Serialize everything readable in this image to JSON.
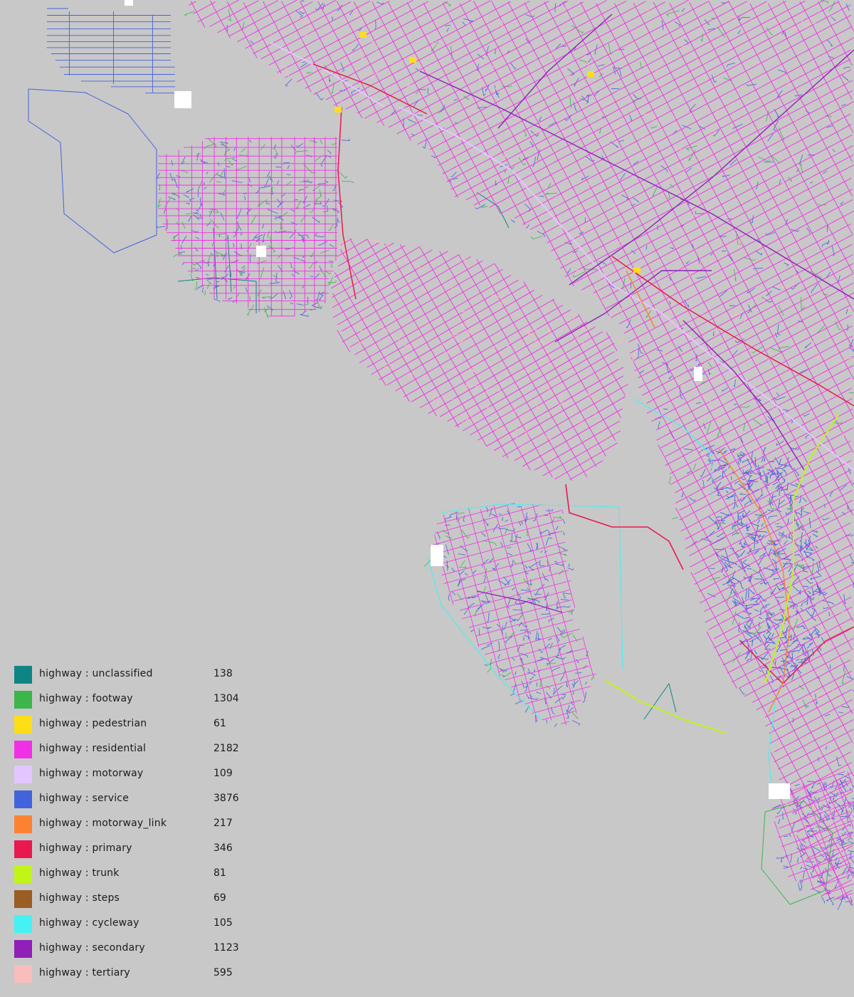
{
  "map": {
    "background": "#c8c8c8",
    "land_color": "#c8c8c8"
  },
  "legend": {
    "items": [
      {
        "key": "unclassified",
        "label": "highway : unclassified",
        "count": "138",
        "color": "#0e8585"
      },
      {
        "key": "footway",
        "label": "highway : footway",
        "count": "1304",
        "color": "#3cb54a"
      },
      {
        "key": "pedestrian",
        "label": "highway : pedestrian",
        "count": "61",
        "color": "#ffdd17"
      },
      {
        "key": "residential",
        "label": "highway : residential",
        "count": "2182",
        "color": "#f030e6"
      },
      {
        "key": "motorway",
        "label": "highway : motorway",
        "count": "109",
        "color": "#e3c6ff"
      },
      {
        "key": "service",
        "label": "highway : service",
        "count": "3876",
        "color": "#4263dc"
      },
      {
        "key": "motorway_link",
        "label": "highway : motorway_link",
        "count": "217",
        "color": "#fa8232"
      },
      {
        "key": "primary",
        "label": "highway : primary",
        "count": "346",
        "color": "#e8194e"
      },
      {
        "key": "trunk",
        "label": "highway : trunk",
        "count": "81",
        "color": "#c0f515"
      },
      {
        "key": "steps",
        "label": "highway : steps",
        "count": "69",
        "color": "#9a5d23"
      },
      {
        "key": "cycleway",
        "label": "highway : cycleway",
        "count": "105",
        "color": "#45f1f2"
      },
      {
        "key": "secondary",
        "label": "highway : secondary",
        "count": "1123",
        "color": "#8f20b8"
      },
      {
        "key": "tertiary",
        "label": "highway : tertiary",
        "count": "595",
        "color": "#fbbcbc"
      }
    ]
  }
}
